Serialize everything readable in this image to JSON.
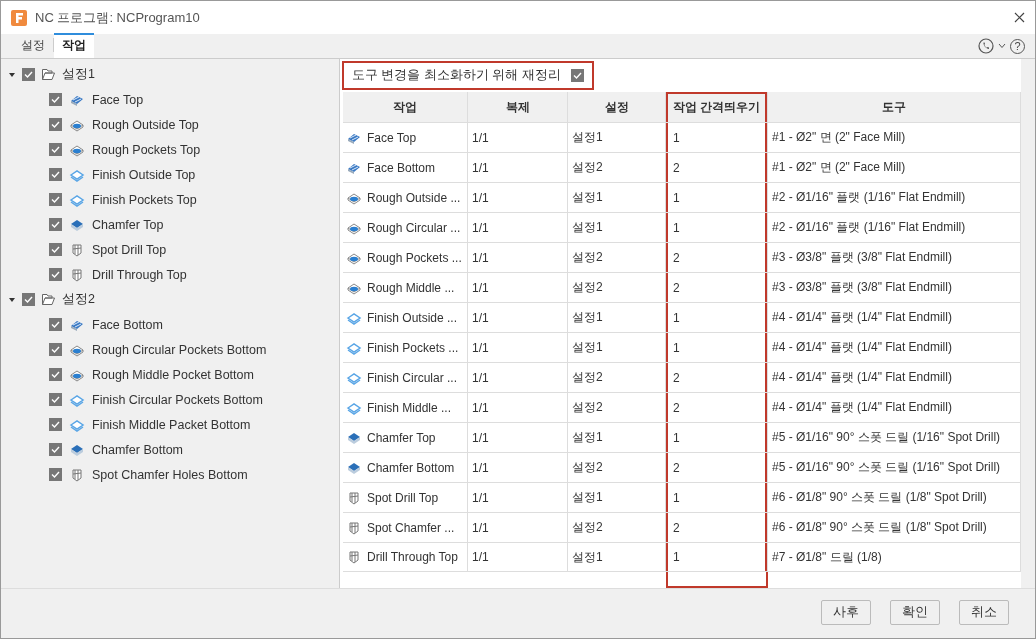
{
  "window": {
    "title": "NC 프로그램: NCProgram10"
  },
  "tabs": [
    {
      "label": "설정",
      "selected": false
    },
    {
      "label": "작업",
      "selected": true
    }
  ],
  "help_button": "?",
  "tree": [
    {
      "label": "설정1",
      "expanded": true,
      "checked": true,
      "children": [
        {
          "label": "Face Top",
          "kind": "face",
          "checked": true
        },
        {
          "label": "Rough Outside Top",
          "kind": "rough",
          "checked": true
        },
        {
          "label": "Rough Pockets Top",
          "kind": "rough",
          "checked": true
        },
        {
          "label": "Finish Outside Top",
          "kind": "finish",
          "checked": true
        },
        {
          "label": "Finish Pockets Top",
          "kind": "finish",
          "checked": true
        },
        {
          "label": "Chamfer Top",
          "kind": "chamfer",
          "checked": true
        },
        {
          "label": "Spot Drill Top",
          "kind": "drill",
          "checked": true
        },
        {
          "label": "Drill Through Top",
          "kind": "drill",
          "checked": true
        }
      ]
    },
    {
      "label": "설정2",
      "expanded": true,
      "checked": true,
      "children": [
        {
          "label": "Face Bottom",
          "kind": "face",
          "checked": true
        },
        {
          "label": "Rough Circular Pockets Bottom",
          "kind": "rough",
          "checked": true
        },
        {
          "label": "Rough Middle Pocket Bottom",
          "kind": "rough",
          "checked": true
        },
        {
          "label": "Finish Circular Pockets Bottom",
          "kind": "finish",
          "checked": true
        },
        {
          "label": "Finish Middle Packet Bottom",
          "kind": "finish",
          "checked": true
        },
        {
          "label": "Chamfer Bottom",
          "kind": "chamfer",
          "checked": true
        },
        {
          "label": "Spot Chamfer Holes Bottom",
          "kind": "drill",
          "checked": true
        }
      ]
    }
  ],
  "reorder_option": {
    "label": "도구 변경을 최소화하기 위해 재정리",
    "checked": true,
    "highlighted": true
  },
  "table": {
    "columns": [
      {
        "label": "작업",
        "highlighted": false
      },
      {
        "label": "복제",
        "highlighted": false
      },
      {
        "label": "설정",
        "highlighted": false
      },
      {
        "label": "작업 간격띄우기",
        "highlighted": true
      },
      {
        "label": "도구",
        "highlighted": false
      }
    ],
    "rows": [
      {
        "operation": "Face Top",
        "kind": "face",
        "copy": "1/1",
        "setup": "설정1",
        "spacing": "1",
        "tool": "#1 - Ø2\" 면 (2\" Face Mill)"
      },
      {
        "operation": "Face Bottom",
        "kind": "face",
        "copy": "1/1",
        "setup": "설정2",
        "spacing": "2",
        "tool": "#1 - Ø2\" 면 (2\" Face Mill)"
      },
      {
        "operation": "Rough Outside ...",
        "kind": "rough",
        "copy": "1/1",
        "setup": "설정1",
        "spacing": "1",
        "tool": "#2 - Ø1/16\" 플랫 (1/16\" Flat Endmill)"
      },
      {
        "operation": "Rough Circular ...",
        "kind": "rough",
        "copy": "1/1",
        "setup": "설정1",
        "spacing": "1",
        "tool": "#2 - Ø1/16\" 플랫 (1/16\" Flat Endmill)"
      },
      {
        "operation": "Rough Pockets ...",
        "kind": "rough",
        "copy": "1/1",
        "setup": "설정2",
        "spacing": "2",
        "tool": "#3 - Ø3/8\" 플랫 (3/8\" Flat Endmill)"
      },
      {
        "operation": "Rough Middle ...",
        "kind": "rough",
        "copy": "1/1",
        "setup": "설정2",
        "spacing": "2",
        "tool": "#3 - Ø3/8\" 플랫 (3/8\" Flat Endmill)"
      },
      {
        "operation": "Finish Outside ...",
        "kind": "finish",
        "copy": "1/1",
        "setup": "설정1",
        "spacing": "1",
        "tool": "#4 - Ø1/4\" 플랫 (1/4\" Flat Endmill)"
      },
      {
        "operation": "Finish Pockets ...",
        "kind": "finish",
        "copy": "1/1",
        "setup": "설정1",
        "spacing": "1",
        "tool": "#4 - Ø1/4\" 플랫 (1/4\" Flat Endmill)"
      },
      {
        "operation": "Finish Circular ...",
        "kind": "finish",
        "copy": "1/1",
        "setup": "설정2",
        "spacing": "2",
        "tool": "#4 - Ø1/4\" 플랫 (1/4\" Flat Endmill)"
      },
      {
        "operation": "Finish Middle ...",
        "kind": "finish",
        "copy": "1/1",
        "setup": "설정2",
        "spacing": "2",
        "tool": "#4 - Ø1/4\" 플랫 (1/4\" Flat Endmill)"
      },
      {
        "operation": "Chamfer Top",
        "kind": "chamfer",
        "copy": "1/1",
        "setup": "설정1",
        "spacing": "1",
        "tool": "#5 - Ø1/16\" 90° 스폿 드릴 (1/16\" Spot Drill)"
      },
      {
        "operation": "Chamfer Bottom",
        "kind": "chamfer",
        "copy": "1/1",
        "setup": "설정2",
        "spacing": "2",
        "tool": "#5 - Ø1/16\" 90° 스폿 드릴 (1/16\" Spot Drill)"
      },
      {
        "operation": "Spot Drill Top",
        "kind": "drill",
        "copy": "1/1",
        "setup": "설정1",
        "spacing": "1",
        "tool": "#6 - Ø1/8\" 90° 스폿 드릴 (1/8\" Spot Drill)"
      },
      {
        "operation": "Spot Chamfer ...",
        "kind": "drill",
        "copy": "1/1",
        "setup": "설정2",
        "spacing": "2",
        "tool": "#6 - Ø1/8\" 90° 스폿 드릴 (1/8\" Spot Drill)"
      },
      {
        "operation": "Drill Through Top",
        "kind": "drill",
        "copy": "1/1",
        "setup": "설정1",
        "spacing": "1",
        "tool": "#7 - Ø1/8\" 드릴 (1/8)"
      }
    ]
  },
  "buttons": [
    "사후",
    "확인",
    "취소"
  ]
}
